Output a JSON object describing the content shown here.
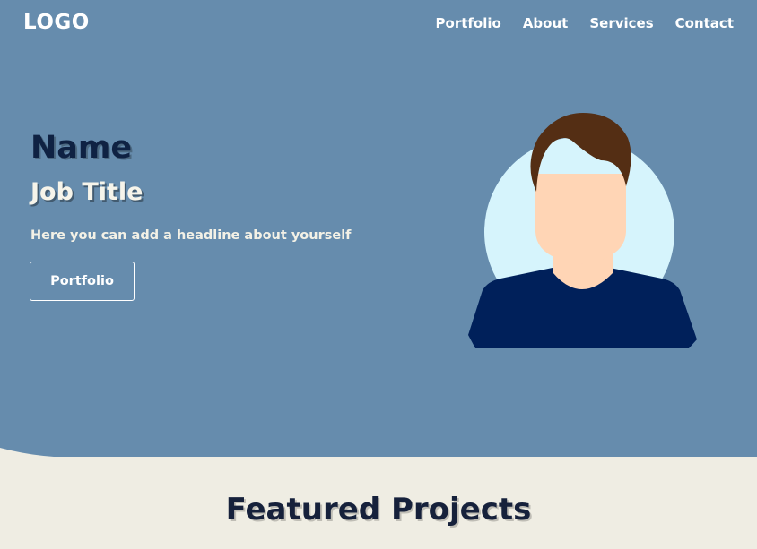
{
  "header": {
    "logo": "LOGO",
    "nav": [
      {
        "label": "Portfolio"
      },
      {
        "label": "About"
      },
      {
        "label": "Services"
      },
      {
        "label": "Contact"
      }
    ]
  },
  "hero": {
    "name": "Name",
    "job_title": "Job Title",
    "headline": "Here you can add a headline about yourself",
    "button_label": "Portfolio"
  },
  "featured": {
    "title": "Featured Projects"
  },
  "colors": {
    "hero_bg": "#668cad",
    "page_bg": "#efede3",
    "name_text": "#0f2243",
    "avatar_circle": "#d6f4fc",
    "avatar_skin": "#ffd5b5",
    "avatar_hair": "#542e14",
    "avatar_shirt": "#00205a"
  }
}
